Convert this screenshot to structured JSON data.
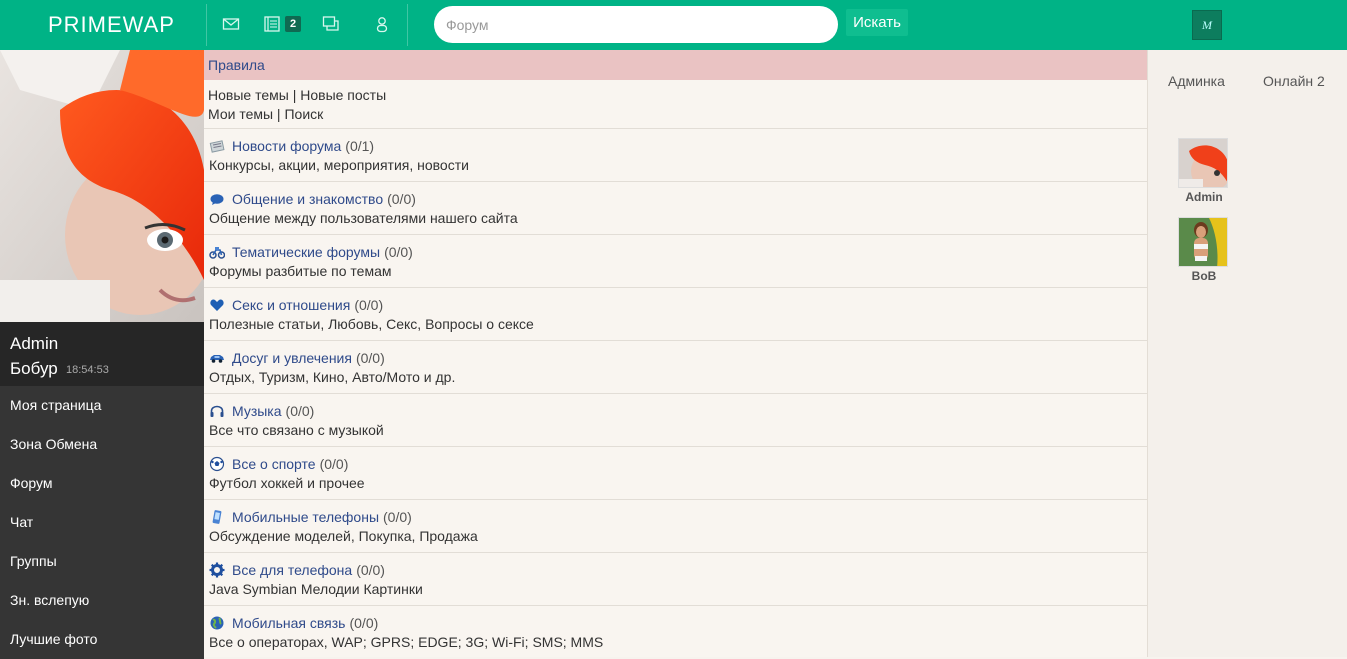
{
  "header": {
    "logo": "PRIMEWAP",
    "badge_count": "2",
    "search_placeholder": "Форум",
    "search_button": "Искать",
    "avatar_letter": "M"
  },
  "user": {
    "name_line1": "Admin",
    "name_line2": "Бобур",
    "time": "18:54:53"
  },
  "menu": [
    {
      "label": "Моя страница"
    },
    {
      "label": "Зона Обмена"
    },
    {
      "label": "Форум"
    },
    {
      "label": "Чат"
    },
    {
      "label": "Группы"
    },
    {
      "label": "Зн. вслепую"
    },
    {
      "label": "Лучшие фото"
    }
  ],
  "main": {
    "rules": "Правила",
    "links": {
      "new_topics": "Новые темы",
      "sep": " | ",
      "new_posts": "Новые посты",
      "my_topics": "Мои темы",
      "search": "Поиск"
    },
    "sections": [
      {
        "icon": "newspaper-icon",
        "title": "Новости форума",
        "count": "(0/1)",
        "desc": "Конкурсы, акции, мероприятия, новости"
      },
      {
        "icon": "chat-bubble-icon",
        "title": "Общение и знакомство",
        "count": "(0/0)",
        "desc": "Общение между пользователями нашего сайта"
      },
      {
        "icon": "motorbike-icon",
        "title": "Тематические форумы",
        "count": "(0/0)",
        "desc": "Форумы разбитые по темам"
      },
      {
        "icon": "heart-icon",
        "title": "Секс и отношения",
        "count": "(0/0)",
        "desc": "Полезные статьи, Любовь, Секс, Вопросы о сексе"
      },
      {
        "icon": "car-icon",
        "title": "Досуг и увлечения",
        "count": "(0/0)",
        "desc": "Отдых, Туризм, Кино, Авто/Мото и др."
      },
      {
        "icon": "headphones-icon",
        "title": "Музыка",
        "count": "(0/0)",
        "desc": "Все что связано с музыкой"
      },
      {
        "icon": "soccer-ball-icon",
        "title": "Все о спорте",
        "count": "(0/0)",
        "desc": "Футбол хоккей и прочее"
      },
      {
        "icon": "mobile-phone-icon",
        "title": "Мобильные телефоны",
        "count": "(0/0)",
        "desc": "Обсуждение моделей, Покупка, Продажа"
      },
      {
        "icon": "gear-icon",
        "title": "Все для телефона",
        "count": "(0/0)",
        "desc": "Java Symbian Мелодии Картинки"
      },
      {
        "icon": "globe-icon",
        "title": "Мобильная связь",
        "count": "(0/0)",
        "desc": "Все о операторах, WAP; GPRS; EDGE; 3G; Wi-Fi; SMS; MMS"
      }
    ]
  },
  "right": {
    "tab_admin": "Админка",
    "tab_online": "Онлайн 2",
    "online_users": [
      {
        "name": "Admin"
      },
      {
        "name": "BoB"
      }
    ]
  },
  "colors": {
    "header": "#00b386",
    "link": "#2f4a8a",
    "rules_bg": "#eac3c3",
    "sidebar": "#353535"
  }
}
